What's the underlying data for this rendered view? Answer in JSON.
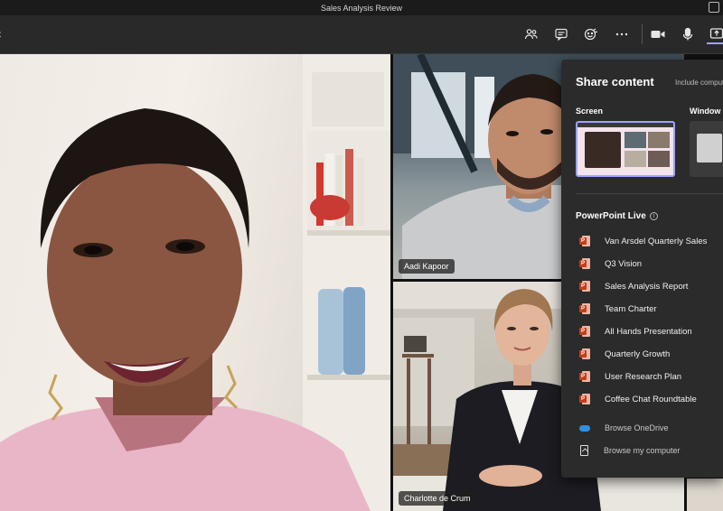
{
  "window": {
    "title": "Sales Analysis Review"
  },
  "participants": {
    "top_right_name": "Aadi Kapoor",
    "bottom_right_name": "Charlotte de Crum"
  },
  "share_panel": {
    "title": "Share content",
    "include_label": "Include computer sound",
    "screen_label": "Screen",
    "window_label": "Window",
    "powerpoint_label": "PowerPoint Live",
    "files": [
      "Van Arsdel Quarterly Sales",
      "Q3 Vision",
      "Sales Analysis Report",
      "Team Charter",
      "All Hands Presentation",
      "Quarterly Growth",
      "User Research Plan",
      "Coffee Chat Roundtable"
    ],
    "browse_onedrive": "Browse OneDrive",
    "browse_computer": "Browse my computer"
  },
  "toolbar_icons": [
    "people-icon",
    "chat-icon",
    "reactions-icon",
    "more-icon",
    "camera-icon",
    "mic-icon",
    "share-icon"
  ],
  "colors": {
    "accent": "#9ea2ff",
    "ppt_red": "#c43e1c",
    "onedrive_blue": "#2f8fe0"
  }
}
